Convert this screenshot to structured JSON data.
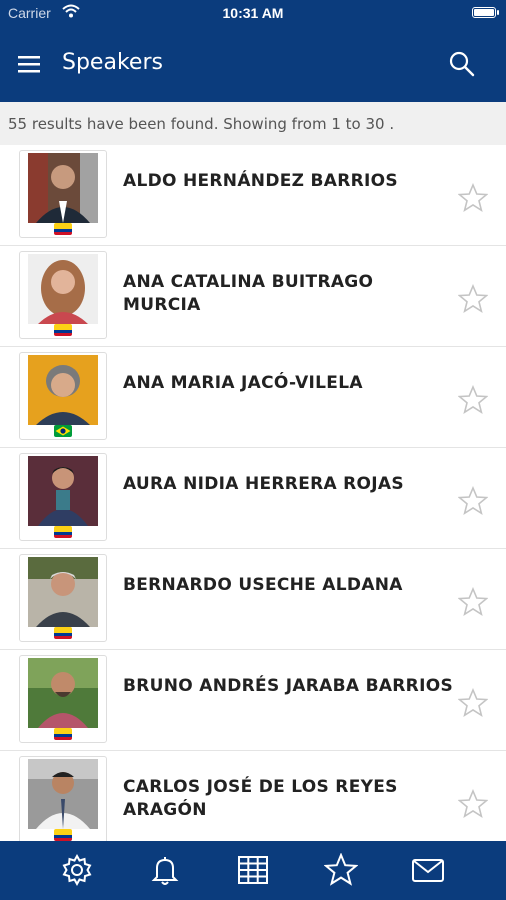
{
  "status_bar": {
    "carrier": "Carrier",
    "time": "10:31 AM"
  },
  "header": {
    "title": "Speakers"
  },
  "results_text": "55 results have been found. Showing from 1 to 30 .",
  "speakers": [
    {
      "name": "ALDO HERNÁNDEZ BARRIOS",
      "flag": "colombia"
    },
    {
      "name": "ANA CATALINA BUITRAGO MURCIA",
      "flag": "colombia"
    },
    {
      "name": "ANA MARIA JACÓ-VILELA",
      "flag": "brazil"
    },
    {
      "name": "AURA NIDIA HERRERA ROJAS",
      "flag": "colombia"
    },
    {
      "name": "BERNARDO USECHE ALDANA",
      "flag": "colombia"
    },
    {
      "name": "BRUNO ANDRÉS JARABA BARRIOS",
      "flag": "colombia"
    },
    {
      "name": "CARLOS JOSÉ DE LOS REYES ARAGÓN",
      "flag": "colombia"
    }
  ],
  "tab_bar": {
    "icons": [
      "gear-icon",
      "bell-icon",
      "grid-icon",
      "star-icon",
      "mail-icon"
    ]
  },
  "colors": {
    "brand": "#0b3c7d",
    "results_bg": "#f0f0f0"
  }
}
